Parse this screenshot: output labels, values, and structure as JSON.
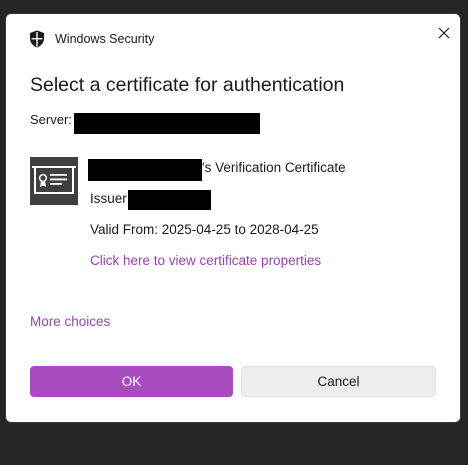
{
  "window": {
    "title": "Windows Security",
    "close_icon": "close-icon",
    "shield_icon": "shield-icon"
  },
  "dialog": {
    "heading": "Select a certificate for authentication",
    "server_label": "Server:",
    "server_value_redacted": true
  },
  "certificate": {
    "icon": "certificate-icon",
    "name_suffix": "'s Verification Certificate",
    "issuer_label": "Issuer:",
    "valid_from": "Valid From: 2025-04-25 to 2028-04-25",
    "properties_link": "Click here to view certificate properties"
  },
  "more_choices": "More choices",
  "buttons": {
    "ok": "OK",
    "cancel": "Cancel"
  },
  "colors": {
    "accent": "#a84ac0",
    "link": "#9b3fb5",
    "redaction": "#000000",
    "backdrop": "#262626"
  }
}
